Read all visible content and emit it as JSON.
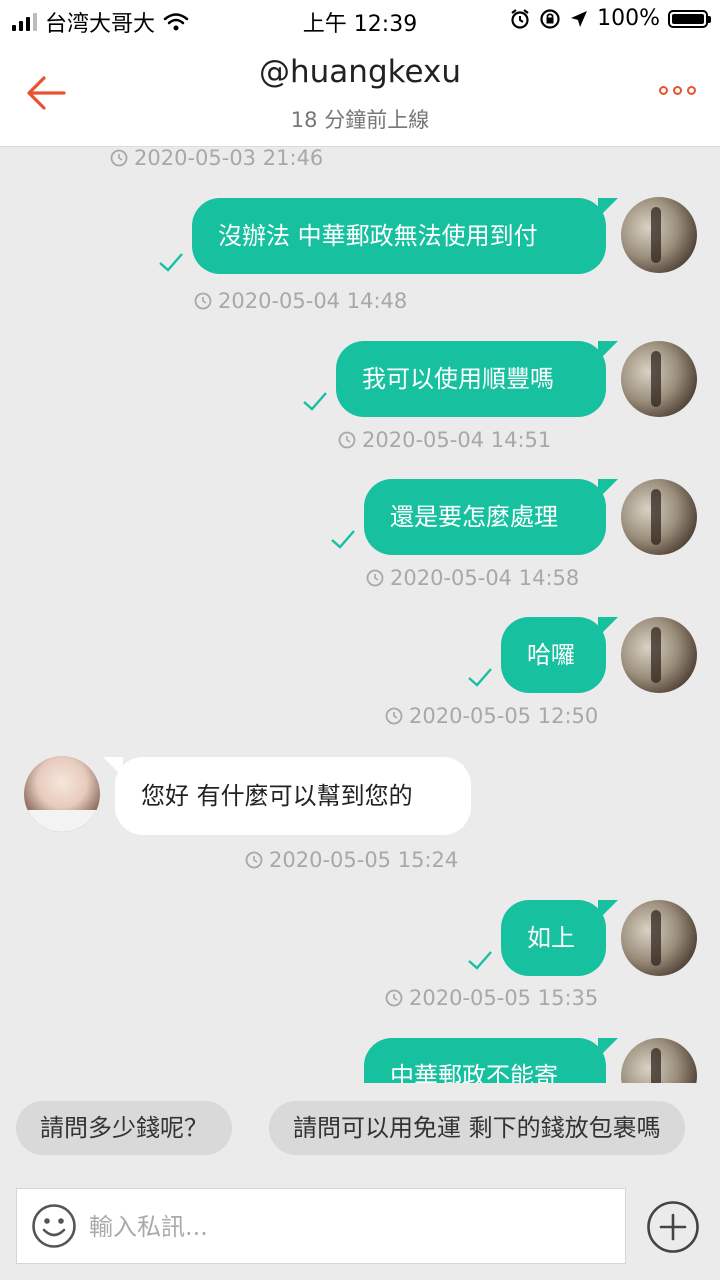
{
  "status_bar": {
    "carrier": "台湾大哥大",
    "time": "上午 12:39",
    "battery": "100%"
  },
  "header": {
    "title": "@huangkexu",
    "subtitle": "18 分鐘前上線"
  },
  "colors": {
    "accent": "#17c1a0",
    "back_arrow": "#e8522e",
    "background": "#ebebeb"
  },
  "messages": [
    {
      "timestamp": "2020-05-03 21:46"
    },
    {
      "direction": "out",
      "text": "沒辦法 中華郵政無法使用到付",
      "timestamp": "2020-05-04 14:48",
      "read": true
    },
    {
      "direction": "out",
      "text": "我可以使用順豐嗎",
      "timestamp": "2020-05-04 14:51",
      "read": true
    },
    {
      "direction": "out",
      "text": "還是要怎麼處理",
      "timestamp": "2020-05-04 14:58",
      "read": true
    },
    {
      "direction": "out",
      "text": "哈囉",
      "timestamp": "2020-05-05 12:50",
      "read": true
    },
    {
      "direction": "in",
      "text": "您好 有什麼可以幫到您的",
      "timestamp": "2020-05-05 15:24"
    },
    {
      "direction": "out",
      "text": "如上",
      "timestamp": "2020-05-05 15:35",
      "read": true
    },
    {
      "direction": "out",
      "text": "中華郵政不能寄"
    }
  ],
  "quick_replies": [
    "請問多少錢呢？",
    "請問可以用免運 剩下的錢放包裹嗎"
  ],
  "composer": {
    "placeholder": "輸入私訊..."
  },
  "icons": {
    "back": "arrow-left-icon",
    "more": "more-dots-icon",
    "emoji": "smiley-icon",
    "add": "plus-circle-icon",
    "read": "checkmark-icon",
    "time": "clock-icon"
  }
}
